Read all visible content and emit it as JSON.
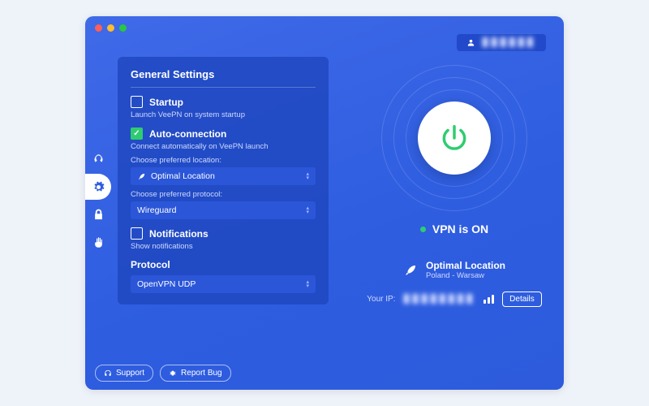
{
  "profile": {
    "username": "██████"
  },
  "settings": {
    "title": "General Settings",
    "startup": {
      "label": "Startup",
      "desc": "Launch VeePN on system startup",
      "checked": false
    },
    "autoconn": {
      "label": "Auto-connection",
      "desc": "Connect automatically on VeePN launch",
      "checked": true,
      "location_label": "Choose preferred location:",
      "location_value": "Optimal Location",
      "protocol_label": "Choose preferred protocol:",
      "protocol_value": "Wireguard"
    },
    "notifications": {
      "label": "Notifications",
      "desc": "Show notifications",
      "checked": false
    },
    "protocol": {
      "heading": "Protocol",
      "value": "OpenVPN UDP"
    }
  },
  "status": {
    "text": "VPN is ON",
    "on": true
  },
  "location": {
    "title": "Optimal Location",
    "sub": "Poland - Warsaw"
  },
  "ip": {
    "label": "Your IP:",
    "value": "████████",
    "details": "Details"
  },
  "footer": {
    "support": "Support",
    "report": "Report Bug"
  }
}
